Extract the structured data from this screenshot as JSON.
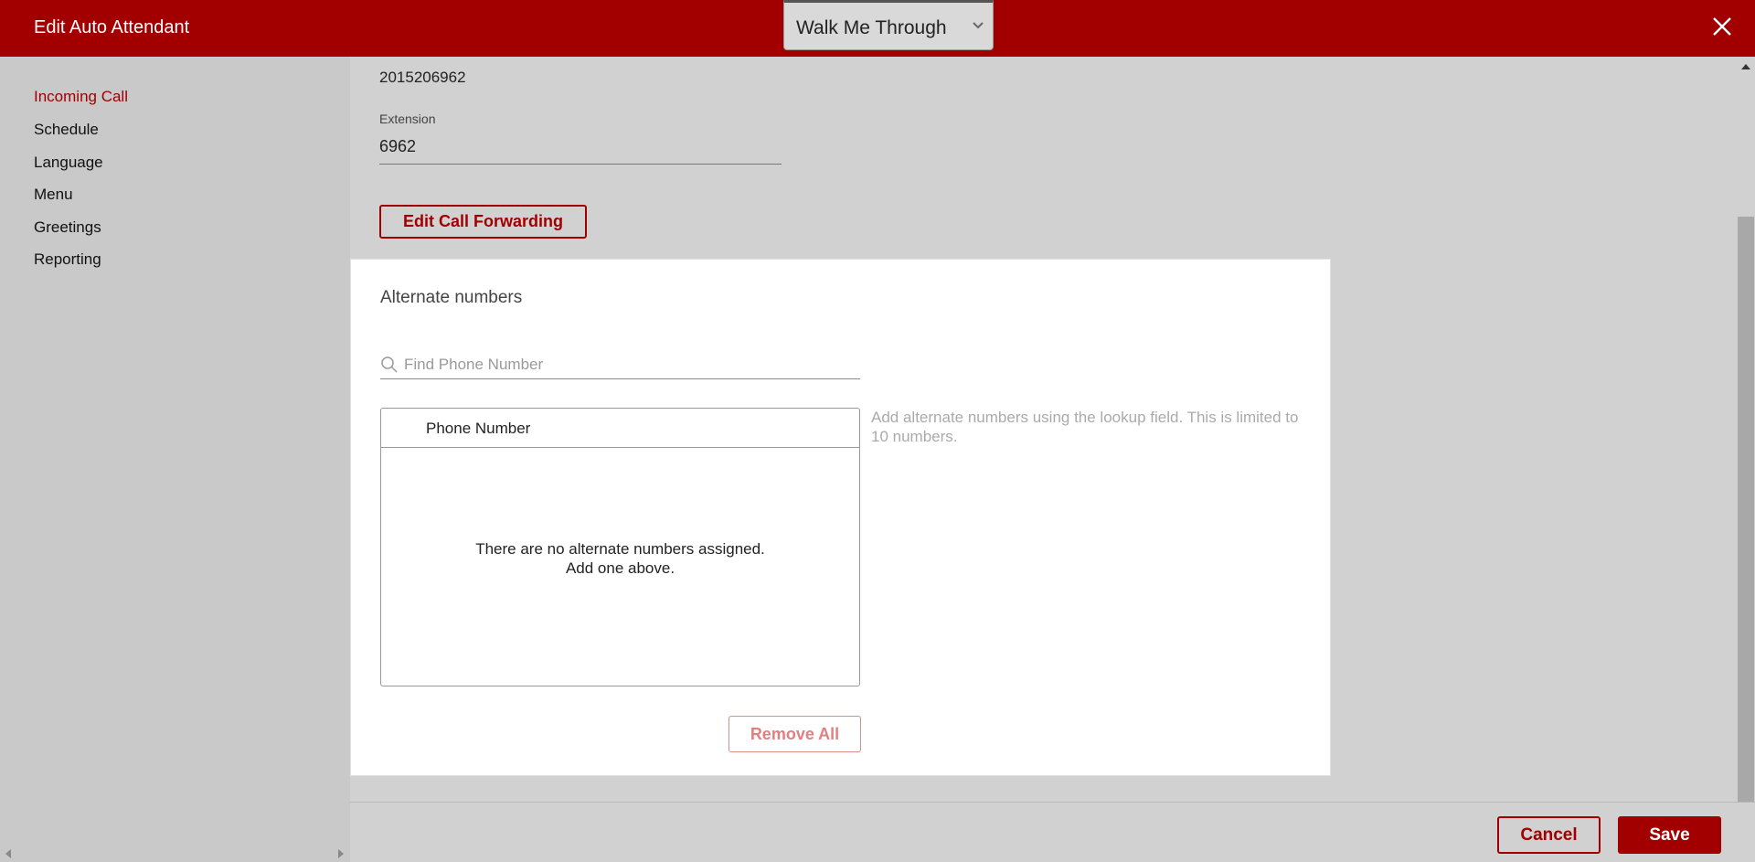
{
  "header": {
    "title": "Edit Auto Attendant",
    "walkme_label": "Walk Me Through",
    "close_icon": "close-icon",
    "brand_color": "#a20000"
  },
  "sidebar": {
    "items": [
      {
        "label": "Incoming Call",
        "active": true
      },
      {
        "label": "Schedule",
        "active": false
      },
      {
        "label": "Language",
        "active": false
      },
      {
        "label": "Menu",
        "active": false
      },
      {
        "label": "Greetings",
        "active": false
      },
      {
        "label": "Reporting",
        "active": false
      }
    ]
  },
  "main": {
    "number": "2015206962",
    "extension_label": "Extension",
    "extension_value": "6962",
    "edit_call_forwarding_label": "Edit Call Forwarding",
    "alternate": {
      "title": "Alternate numbers",
      "search_placeholder": "Find Phone Number",
      "search_icon": "search-icon",
      "table_header": "Phone Number",
      "empty_line1": "There are no alternate numbers assigned.",
      "empty_line2": "Add one above.",
      "hint": "Add alternate numbers using the lookup field. This is limited to 10 numbers.",
      "remove_all_label": "Remove All"
    }
  },
  "footer": {
    "cancel_label": "Cancel",
    "save_label": "Save"
  }
}
